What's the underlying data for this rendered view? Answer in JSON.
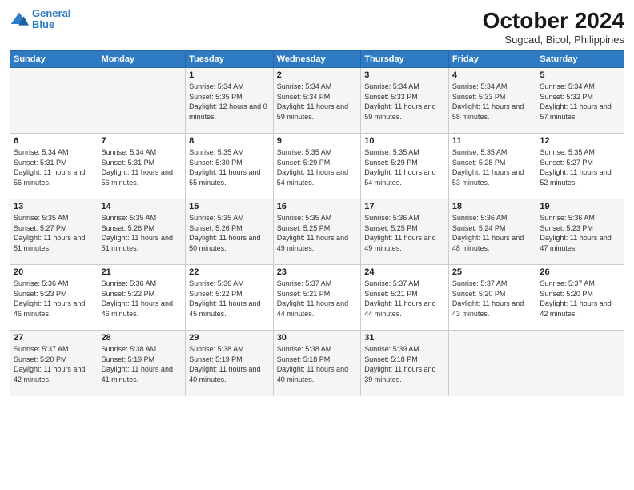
{
  "logo": {
    "line1": "General",
    "line2": "Blue"
  },
  "title": "October 2024",
  "subtitle": "Sugcad, Bicol, Philippines",
  "headers": [
    "Sunday",
    "Monday",
    "Tuesday",
    "Wednesday",
    "Thursday",
    "Friday",
    "Saturday"
  ],
  "weeks": [
    [
      {
        "day": "",
        "sunrise": "",
        "sunset": "",
        "daylight": ""
      },
      {
        "day": "",
        "sunrise": "",
        "sunset": "",
        "daylight": ""
      },
      {
        "day": "1",
        "sunrise": "Sunrise: 5:34 AM",
        "sunset": "Sunset: 5:35 PM",
        "daylight": "Daylight: 12 hours and 0 minutes."
      },
      {
        "day": "2",
        "sunrise": "Sunrise: 5:34 AM",
        "sunset": "Sunset: 5:34 PM",
        "daylight": "Daylight: 11 hours and 59 minutes."
      },
      {
        "day": "3",
        "sunrise": "Sunrise: 5:34 AM",
        "sunset": "Sunset: 5:33 PM",
        "daylight": "Daylight: 11 hours and 59 minutes."
      },
      {
        "day": "4",
        "sunrise": "Sunrise: 5:34 AM",
        "sunset": "Sunset: 5:33 PM",
        "daylight": "Daylight: 11 hours and 58 minutes."
      },
      {
        "day": "5",
        "sunrise": "Sunrise: 5:34 AM",
        "sunset": "Sunset: 5:32 PM",
        "daylight": "Daylight: 11 hours and 57 minutes."
      }
    ],
    [
      {
        "day": "6",
        "sunrise": "Sunrise: 5:34 AM",
        "sunset": "Sunset: 5:31 PM",
        "daylight": "Daylight: 11 hours and 56 minutes."
      },
      {
        "day": "7",
        "sunrise": "Sunrise: 5:34 AM",
        "sunset": "Sunset: 5:31 PM",
        "daylight": "Daylight: 11 hours and 56 minutes."
      },
      {
        "day": "8",
        "sunrise": "Sunrise: 5:35 AM",
        "sunset": "Sunset: 5:30 PM",
        "daylight": "Daylight: 11 hours and 55 minutes."
      },
      {
        "day": "9",
        "sunrise": "Sunrise: 5:35 AM",
        "sunset": "Sunset: 5:29 PM",
        "daylight": "Daylight: 11 hours and 54 minutes."
      },
      {
        "day": "10",
        "sunrise": "Sunrise: 5:35 AM",
        "sunset": "Sunset: 5:29 PM",
        "daylight": "Daylight: 11 hours and 54 minutes."
      },
      {
        "day": "11",
        "sunrise": "Sunrise: 5:35 AM",
        "sunset": "Sunset: 5:28 PM",
        "daylight": "Daylight: 11 hours and 53 minutes."
      },
      {
        "day": "12",
        "sunrise": "Sunrise: 5:35 AM",
        "sunset": "Sunset: 5:27 PM",
        "daylight": "Daylight: 11 hours and 52 minutes."
      }
    ],
    [
      {
        "day": "13",
        "sunrise": "Sunrise: 5:35 AM",
        "sunset": "Sunset: 5:27 PM",
        "daylight": "Daylight: 11 hours and 51 minutes."
      },
      {
        "day": "14",
        "sunrise": "Sunrise: 5:35 AM",
        "sunset": "Sunset: 5:26 PM",
        "daylight": "Daylight: 11 hours and 51 minutes."
      },
      {
        "day": "15",
        "sunrise": "Sunrise: 5:35 AM",
        "sunset": "Sunset: 5:26 PM",
        "daylight": "Daylight: 11 hours and 50 minutes."
      },
      {
        "day": "16",
        "sunrise": "Sunrise: 5:35 AM",
        "sunset": "Sunset: 5:25 PM",
        "daylight": "Daylight: 11 hours and 49 minutes."
      },
      {
        "day": "17",
        "sunrise": "Sunrise: 5:36 AM",
        "sunset": "Sunset: 5:25 PM",
        "daylight": "Daylight: 11 hours and 49 minutes."
      },
      {
        "day": "18",
        "sunrise": "Sunrise: 5:36 AM",
        "sunset": "Sunset: 5:24 PM",
        "daylight": "Daylight: 11 hours and 48 minutes."
      },
      {
        "day": "19",
        "sunrise": "Sunrise: 5:36 AM",
        "sunset": "Sunset: 5:23 PM",
        "daylight": "Daylight: 11 hours and 47 minutes."
      }
    ],
    [
      {
        "day": "20",
        "sunrise": "Sunrise: 5:36 AM",
        "sunset": "Sunset: 5:23 PM",
        "daylight": "Daylight: 11 hours and 46 minutes."
      },
      {
        "day": "21",
        "sunrise": "Sunrise: 5:36 AM",
        "sunset": "Sunset: 5:22 PM",
        "daylight": "Daylight: 11 hours and 46 minutes."
      },
      {
        "day": "22",
        "sunrise": "Sunrise: 5:36 AM",
        "sunset": "Sunset: 5:22 PM",
        "daylight": "Daylight: 11 hours and 45 minutes."
      },
      {
        "day": "23",
        "sunrise": "Sunrise: 5:37 AM",
        "sunset": "Sunset: 5:21 PM",
        "daylight": "Daylight: 11 hours and 44 minutes."
      },
      {
        "day": "24",
        "sunrise": "Sunrise: 5:37 AM",
        "sunset": "Sunset: 5:21 PM",
        "daylight": "Daylight: 11 hours and 44 minutes."
      },
      {
        "day": "25",
        "sunrise": "Sunrise: 5:37 AM",
        "sunset": "Sunset: 5:20 PM",
        "daylight": "Daylight: 11 hours and 43 minutes."
      },
      {
        "day": "26",
        "sunrise": "Sunrise: 5:37 AM",
        "sunset": "Sunset: 5:20 PM",
        "daylight": "Daylight: 11 hours and 42 minutes."
      }
    ],
    [
      {
        "day": "27",
        "sunrise": "Sunrise: 5:37 AM",
        "sunset": "Sunset: 5:20 PM",
        "daylight": "Daylight: 11 hours and 42 minutes."
      },
      {
        "day": "28",
        "sunrise": "Sunrise: 5:38 AM",
        "sunset": "Sunset: 5:19 PM",
        "daylight": "Daylight: 11 hours and 41 minutes."
      },
      {
        "day": "29",
        "sunrise": "Sunrise: 5:38 AM",
        "sunset": "Sunset: 5:19 PM",
        "daylight": "Daylight: 11 hours and 40 minutes."
      },
      {
        "day": "30",
        "sunrise": "Sunrise: 5:38 AM",
        "sunset": "Sunset: 5:18 PM",
        "daylight": "Daylight: 11 hours and 40 minutes."
      },
      {
        "day": "31",
        "sunrise": "Sunrise: 5:39 AM",
        "sunset": "Sunset: 5:18 PM",
        "daylight": "Daylight: 11 hours and 39 minutes."
      },
      {
        "day": "",
        "sunrise": "",
        "sunset": "",
        "daylight": ""
      },
      {
        "day": "",
        "sunrise": "",
        "sunset": "",
        "daylight": ""
      }
    ]
  ]
}
